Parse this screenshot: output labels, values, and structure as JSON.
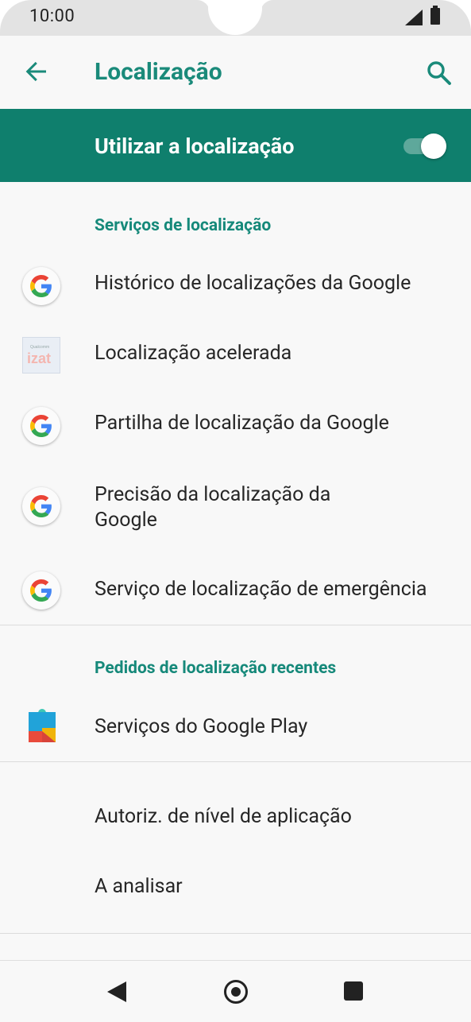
{
  "status": {
    "time": "10:00"
  },
  "header": {
    "title": "Localização"
  },
  "master": {
    "label": "Utilizar a localização",
    "enabled": true
  },
  "services": {
    "heading": "Serviços de localização",
    "items": [
      {
        "label": "Histórico de localizações da Google",
        "icon": "google-icon"
      },
      {
        "label": "Localização acelerada",
        "icon": "izat-icon",
        "icon_text": "izat"
      },
      {
        "label": "Partilha de localização da Google",
        "icon": "google-icon"
      },
      {
        "label": "Precisão da localização da Google",
        "icon": "google-icon"
      },
      {
        "label": "Serviço de localização de emergência",
        "icon": "google-icon"
      }
    ]
  },
  "recent": {
    "heading": "Pedidos de localização recentes",
    "items": [
      {
        "label": "Serviços do Google Play",
        "icon": "google-play-services-icon"
      }
    ]
  },
  "more": {
    "items": [
      {
        "label": "Autoriz. de nível de aplicação"
      },
      {
        "label": "A analisar"
      }
    ]
  },
  "colors": {
    "accent": "#0f7f6d",
    "accent_text": "#1a8a7a"
  }
}
